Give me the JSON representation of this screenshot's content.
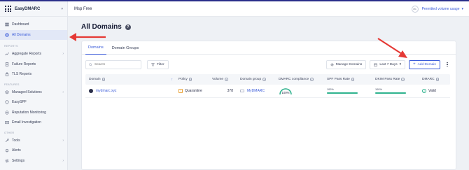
{
  "brand": {
    "name": "EasyDMARC"
  },
  "header": {
    "title": "Msp Free",
    "usage_pct": "0%",
    "usage_label": "Permitted volume usage"
  },
  "sidebar": {
    "top_items": [
      {
        "label": "Dashboard",
        "icon": "dashboard-icon"
      },
      {
        "label": "All Domains",
        "icon": "globe-icon",
        "active": true
      }
    ],
    "reports_title": "REPORTS",
    "reports": [
      {
        "label": "Aggregate Reports",
        "icon": "chart-icon",
        "has_chevron": true
      },
      {
        "label": "Failure Reports",
        "icon": "file-icon"
      },
      {
        "label": "TLS Reports",
        "icon": "lock-icon"
      }
    ],
    "features_title": "FEATURES",
    "features": [
      {
        "label": "Managed Solutions",
        "icon": "layers-icon",
        "has_chevron": true
      },
      {
        "label": "EasySPF",
        "icon": "spf-icon"
      },
      {
        "label": "Reputation Monitoring",
        "icon": "monitor-icon"
      },
      {
        "label": "Email Investigation",
        "icon": "envelope-icon"
      }
    ],
    "other_title": "OTHER",
    "other": [
      {
        "label": "Tools",
        "icon": "tools-icon",
        "has_chevron": true
      },
      {
        "label": "Alerts",
        "icon": "bell-icon"
      },
      {
        "label": "Settings",
        "icon": "gear-icon",
        "has_chevron": true
      }
    ]
  },
  "page": {
    "title": "All Domains"
  },
  "tabs": [
    {
      "label": "Domains",
      "active": true
    },
    {
      "label": "Domain Groups"
    }
  ],
  "toolbar": {
    "search_placeholder": "Search",
    "filter_label": "Filter",
    "manage_label": "Manage Domains",
    "date_label": "Last 7 Days",
    "add_label": "Add Domain"
  },
  "table": {
    "headers": [
      "Domain",
      "Policy",
      "Volume",
      "Domain group",
      "DMARC compliance",
      "SPF Pass Rate",
      "DKIM Pass Rate",
      "DMARC"
    ],
    "rows": [
      {
        "domain": "mydmarc.xyz",
        "policy": "Quarantine",
        "volume": "378",
        "group": "MyDMARC",
        "compliance": "100%",
        "compliance_value": 100,
        "spf": "100%",
        "spf_value": 100,
        "dkim": "100%",
        "dkim_value": 100,
        "dmarc": "Valid"
      }
    ]
  },
  "colors": {
    "accent": "#3a5bd9",
    "success": "#2fb38e",
    "warning": "#e9a43b",
    "annotation": "#e53935"
  }
}
